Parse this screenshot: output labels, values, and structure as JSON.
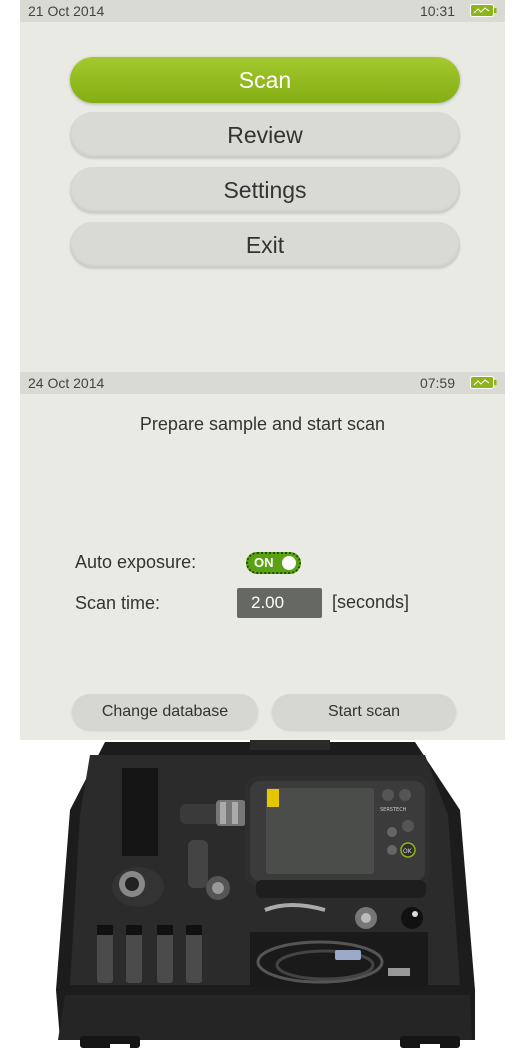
{
  "screen1": {
    "status": {
      "date": "21 Oct 2014",
      "time": "10:31"
    },
    "menu": [
      {
        "label": "Scan",
        "active": true
      },
      {
        "label": "Review",
        "active": false
      },
      {
        "label": "Settings",
        "active": false
      },
      {
        "label": "Exit",
        "active": false
      }
    ]
  },
  "screen2": {
    "status": {
      "date": "24 Oct 2014",
      "time": "07:59"
    },
    "prompt": "Prepare sample and start scan",
    "auto_exposure": {
      "label": "Auto exposure:",
      "toggle_label": "ON",
      "state": "on"
    },
    "scan_time": {
      "label": "Scan time:",
      "value": "2.00",
      "unit": "[seconds]"
    },
    "buttons": {
      "change_database": "Change database",
      "start_scan": "Start scan"
    }
  },
  "photo": {
    "brand_text": "SERSTECH",
    "device_buttons": [
      "power-icon",
      "menu-icon",
      "left-arrow-icon",
      "right-arrow-icon",
      "up-arrow-icon",
      "down-arrow-icon",
      "ok-icon"
    ],
    "ok_label": "OK"
  },
  "colors": {
    "accent_green": "#8cb51c",
    "screen_bg": "#e9eae4",
    "status_bar": "#d9dad4",
    "case_black": "#1c1c1c"
  }
}
